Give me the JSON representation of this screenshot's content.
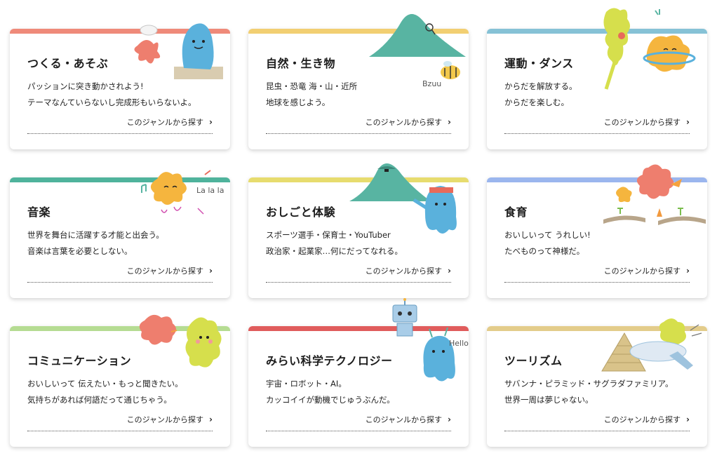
{
  "cards": [
    {
      "title": "つくる・あそぶ",
      "desc1": "パッションに突き動かされよう!",
      "desc2": "テーマなんていらないし完成形もいらないよ。",
      "link": "このジャンルから探す",
      "color": "#ef8a7a"
    },
    {
      "title": "自然・生き物",
      "desc1": "昆虫・恐竜 海・山・近所",
      "desc2": "地球を感じよう。",
      "link": "このジャンルから探す",
      "color": "#f2cf72",
      "illus_text": "Bzuu"
    },
    {
      "title": "運動・ダンス",
      "desc1": "からだを解放する。",
      "desc2": "からだを楽しむ。",
      "link": "このジャンルから探す",
      "color": "#86c2d6"
    },
    {
      "title": "音楽",
      "desc1": "世界を舞台に活躍する才能と出会う。",
      "desc2": "音楽は言葉を必要としない。",
      "link": "このジャンルから探す",
      "color": "#4fb39c",
      "illus_text": "La la la"
    },
    {
      "title": "おしごと体験",
      "desc1": "スポーツ選手・保育士・YouTuber",
      "desc2": "政治家・起業家…何にだってなれる。",
      "link": "このジャンルから探す",
      "color": "#e7dc6e"
    },
    {
      "title": "食育",
      "desc1": "おいしいって うれしい!",
      "desc2": "たべものって神様だ。",
      "link": "このジャンルから探す",
      "color": "#9bb6ee"
    },
    {
      "title": "コミュニケーション",
      "desc1": "おいしいって 伝えたい・もっと聞きたい。",
      "desc2": "気持ちがあれば何語だって通じちゃう。",
      "link": "このジャンルから探す",
      "color": "#b5dc92"
    },
    {
      "title": "みらい科学テクノロジー",
      "desc1": "宇宙・ロボット・AI。",
      "desc2": "カッコイイが動機でじゅうぶんだ。",
      "link": "このジャンルから探す",
      "color": "#e05c5c",
      "illus_text": "Hello"
    },
    {
      "title": "ツーリズム",
      "desc1": "サバンナ・ピラミッド・サグラダファミリア。",
      "desc2": "世界一周は夢じゃない。",
      "link": "このジャンルから探す",
      "color": "#e3cc8a"
    }
  ],
  "icons": {
    "link_arrow": "chevron-right-icon"
  }
}
